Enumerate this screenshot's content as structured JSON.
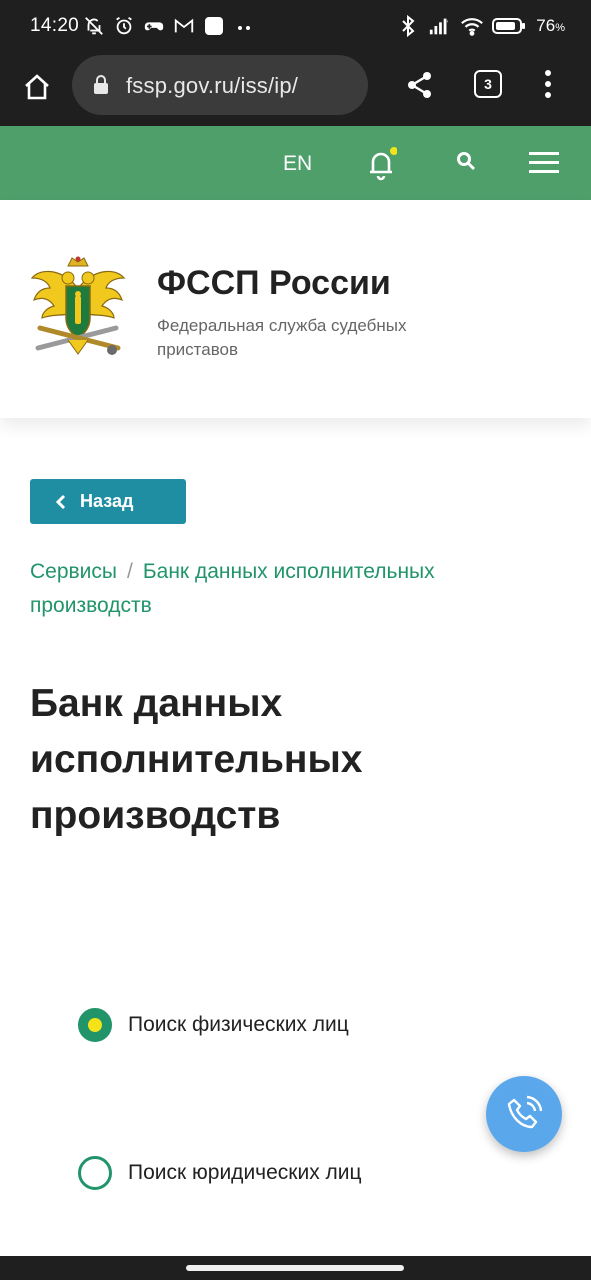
{
  "status_bar": {
    "time": "14:20",
    "battery": "76",
    "battery_unit": "%",
    "left_icons": [
      "muted-bell-icon",
      "alarm-icon",
      "game-controller-icon",
      "gmail-icon",
      "square-notification-icon",
      "more-dots-icon"
    ],
    "right_icons": [
      "bluetooth-icon",
      "signal-icon",
      "wifi-icon",
      "battery-icon"
    ]
  },
  "browser": {
    "url": "fssp.gov.ru/iss/ip/",
    "tab_count": "3"
  },
  "site_header": {
    "lang": "EN",
    "notification_dot_color": "#f5e31a",
    "bar_color": "#4f9f6b"
  },
  "logo": {
    "name": "ФССП России",
    "subtitle": "Федеральная служба судебных приставов"
  },
  "back_button": {
    "label": "Назад",
    "color": "#1f8ea3"
  },
  "breadcrumb": {
    "items": [
      "Сервисы",
      "Банк данных исполнительных производств"
    ],
    "separator": "/"
  },
  "page": {
    "title": "Банк данных исполнительных производств"
  },
  "search_options": [
    {
      "label": "Поиск физических лиц",
      "selected": true
    },
    {
      "label": "Поиск юридических лиц",
      "selected": false
    }
  ],
  "colors": {
    "accent_green": "#21946a",
    "fab_blue": "#5aa7ec"
  }
}
